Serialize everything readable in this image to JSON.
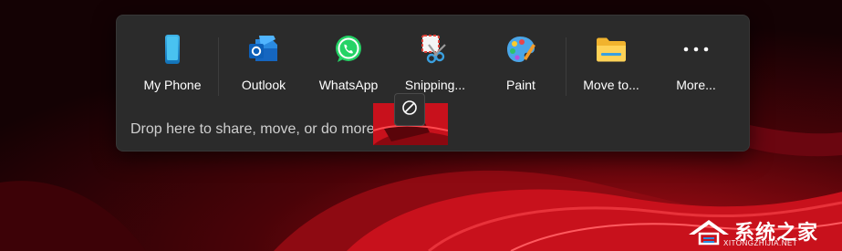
{
  "share_tray": {
    "targets": [
      {
        "label": "My Phone",
        "icon": "phone-icon"
      },
      {
        "label": "Outlook",
        "icon": "outlook-icon"
      },
      {
        "label": "WhatsApp",
        "icon": "whatsapp-icon"
      },
      {
        "label": "Snipping...",
        "icon": "snipping-tool-icon"
      },
      {
        "label": "Paint",
        "icon": "paint-icon"
      },
      {
        "label": "Move to...",
        "icon": "folder-icon"
      },
      {
        "label": "More...",
        "icon": "more-icon"
      }
    ],
    "drop_hint": "Drop here to share, move, or do more"
  },
  "drag": {
    "cursor_icon": "no-drop-icon"
  },
  "watermark": {
    "title": "系统之家",
    "subtitle": "XITONGZHIJIA.NET"
  },
  "colors": {
    "tray_bg": "#2b2b2b",
    "wallpaper_red": "#c8111c",
    "text": "#ffffff"
  }
}
